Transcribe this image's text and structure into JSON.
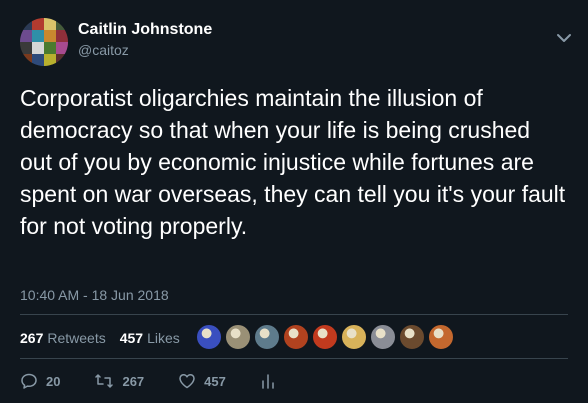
{
  "author": {
    "name": "Caitlin Johnstone",
    "handle": "@caitoz"
  },
  "tweet": {
    "text": "Corporatist oligarchies maintain the illusion of democracy so that when your life is being crushed out of you by economic injustice while fortunes are spent on war overseas, they can tell you it's your fault for not voting properly.",
    "timestamp": "10:40 AM - 18 Jun 2018"
  },
  "stats": {
    "retweets_count": "267",
    "retweets_label": "Retweets",
    "likes_count": "457",
    "likes_label": "Likes"
  },
  "likers": [
    {
      "color": "#3a4fbf"
    },
    {
      "color": "#9a9076"
    },
    {
      "color": "#5e7b8c"
    },
    {
      "color": "#b1421f"
    },
    {
      "color": "#c23a1e"
    },
    {
      "color": "#d8b25a"
    },
    {
      "color": "#8a8d96"
    },
    {
      "color": "#6b4a2e"
    },
    {
      "color": "#c4682e"
    }
  ],
  "actions": {
    "reply_count": "20",
    "retweet_count": "267",
    "like_count": "457"
  },
  "colors": {
    "background": "#10171e",
    "secondary_text": "#8899a6",
    "divider": "#38444d"
  }
}
